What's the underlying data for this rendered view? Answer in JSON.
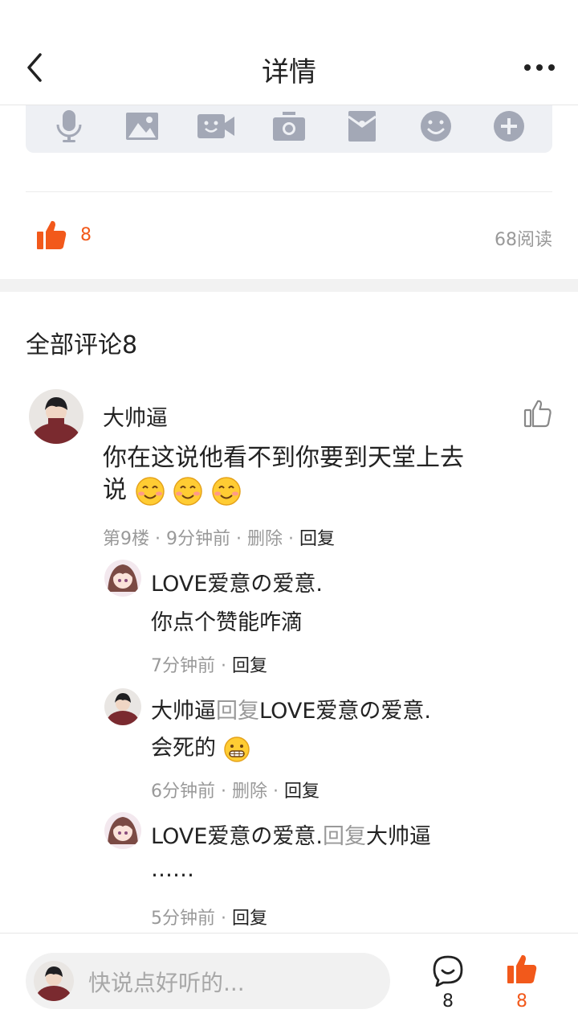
{
  "header": {
    "title": "详情",
    "back_icon": "chevron-left-icon",
    "more_icon": "more-dots-icon"
  },
  "toolbar": {
    "icons": [
      "microphone-icon",
      "image-icon",
      "video-icon",
      "camera-icon",
      "red-envelope-icon",
      "emoji-icon",
      "plus-icon"
    ]
  },
  "post_stats": {
    "like_count": "8",
    "read_count": "68阅读"
  },
  "comments": {
    "heading": "全部评论8",
    "main": {
      "author": "大帅逼",
      "text_line1": "你在这说他看不到你要到天堂上去",
      "text_line2": "说",
      "meta_floor": "第9楼 · 9分钟前 · 删除 · ",
      "meta_reply": "回复"
    },
    "replies": [
      {
        "author": "LOVE爱意の爱意.",
        "text": "你点个赞能咋滴",
        "time": "7分钟前 · ",
        "reply": "回复"
      },
      {
        "author": "大帅逼",
        "reply_word": "回复",
        "target": "LOVE爱意の爱意.",
        "text": "会死的",
        "time": "6分钟前 · 删除 · ",
        "reply": "回复"
      },
      {
        "author": "LOVE爱意の爱意.",
        "reply_word": "回复",
        "target": "大帅逼",
        "text": "……",
        "time": "5分钟前 · ",
        "reply": "回复"
      }
    ]
  },
  "bottom_bar": {
    "placeholder": "快说点好听的...",
    "comment_count": "8",
    "like_count": "8"
  },
  "colors": {
    "accent": "#f2591b",
    "toolbar_bg": "#eef0f4",
    "icon_gray": "#a3a8b6",
    "muted": "#999999"
  }
}
